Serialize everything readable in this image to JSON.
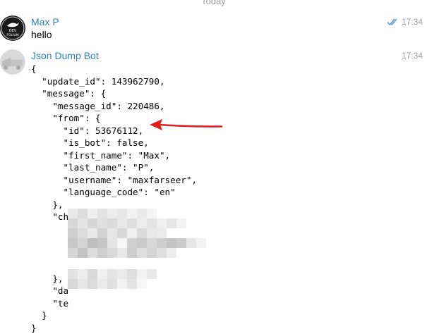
{
  "date_separator": "Today",
  "messages": [
    {
      "sender": "Max P",
      "avatar_text": [
        "DEV",
        "FOLIUM"
      ],
      "text": "hello",
      "time": "17:34",
      "status": "double-check-icon"
    },
    {
      "sender": "Json Dump Bot",
      "time": "17:34",
      "code_lines": [
        "{",
        "  \"update_id\": 143962790,",
        "  \"message\": {",
        "    \"message_id\": 220486,",
        "    \"from\": {",
        "      \"id\": 53676112,",
        "      \"is_bot\": false,",
        "      \"first_name\": \"Max\",",
        "      \"last_name\": \"P\",",
        "      \"username\": \"maxfarseer\",",
        "      \"language_code\": \"en\"",
        "    },",
        "    \"chat\": {",
        "      ",
        "      ",
        "      ",
        "      ",
        "    },",
        "    \"da",
        "    \"te",
        "  }",
        "}"
      ]
    }
  ],
  "colors": {
    "sender_name": "#2f7fc1",
    "timestamp": "#9a9a9a",
    "read_check": "#4a8fd6",
    "annotation_arrow": "#e02020"
  }
}
